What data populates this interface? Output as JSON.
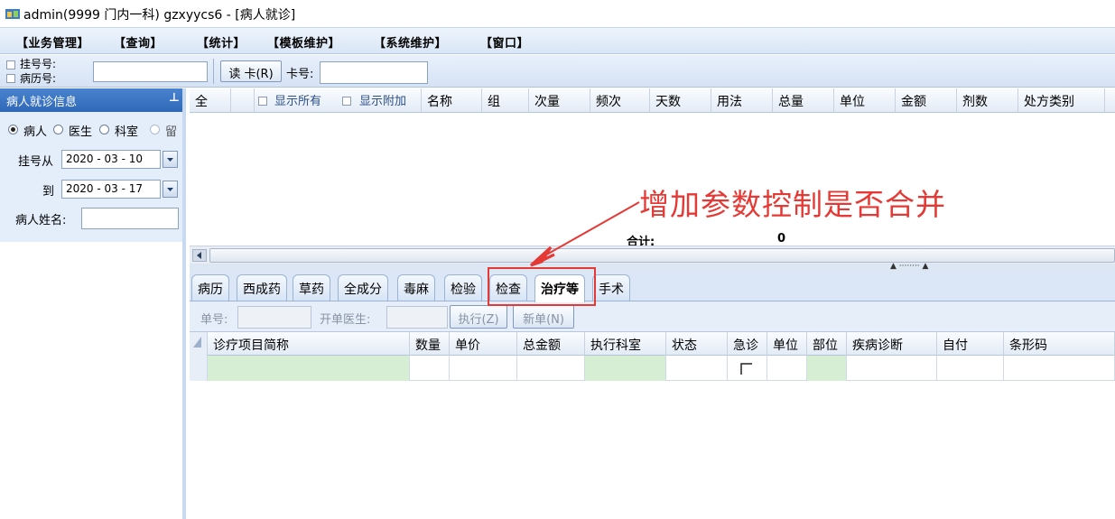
{
  "window": {
    "title": "admin(9999 门内一科) gzxyycs6 - [病人就诊]"
  },
  "menu": [
    "【业务管理】",
    "【查询】",
    "【统计】",
    "【模板维护】",
    "【系统维护】",
    "【窗口】"
  ],
  "toolbar": {
    "guahao_label": "挂号号:",
    "bingli_label": "病历号:",
    "read_card_label": "读 卡(R)",
    "card_no_label": "卡号:"
  },
  "left_panel": {
    "header": "病人就诊信息",
    "pin": "ᵖ",
    "radios": [
      "病人",
      "医生",
      "科室",
      "留"
    ],
    "date_from_label": "挂号从",
    "date_from": "2020 - 03 - 10",
    "date_to_label": "到",
    "date_to": "2020 - 03 - 17",
    "patient_name_label": "病人姓名:"
  },
  "grid1": {
    "all_label": "全",
    "show_all": "显示所有",
    "show_extra": "显示附加",
    "columns": [
      "名称",
      "组",
      "次量",
      "频次",
      "天数",
      "用法",
      "总量",
      "单位",
      "金额",
      "剂数",
      "处方类别"
    ],
    "total_label": "合计:",
    "total_value": "0"
  },
  "tabs": [
    "病历",
    "西成药",
    "草药",
    "全成分",
    "毒麻",
    "检验",
    "检查",
    "治疗等",
    "手术"
  ],
  "active_tab": "治疗等",
  "order_bar": {
    "order_no_label": "单号:",
    "doctor_label": "开单医生:",
    "execute_label": "执行(Z)",
    "new_label": "新单(N)"
  },
  "grid2": {
    "columns": [
      "诊疗项目简称",
      "数量",
      "单价",
      "总金额",
      "执行科室",
      "状态",
      "急诊",
      "单位",
      "部位",
      "疾病诊断",
      "自付",
      "条形码"
    ]
  },
  "annotation": {
    "text": "增加参数控制是否合并",
    "color": "#e53935"
  }
}
